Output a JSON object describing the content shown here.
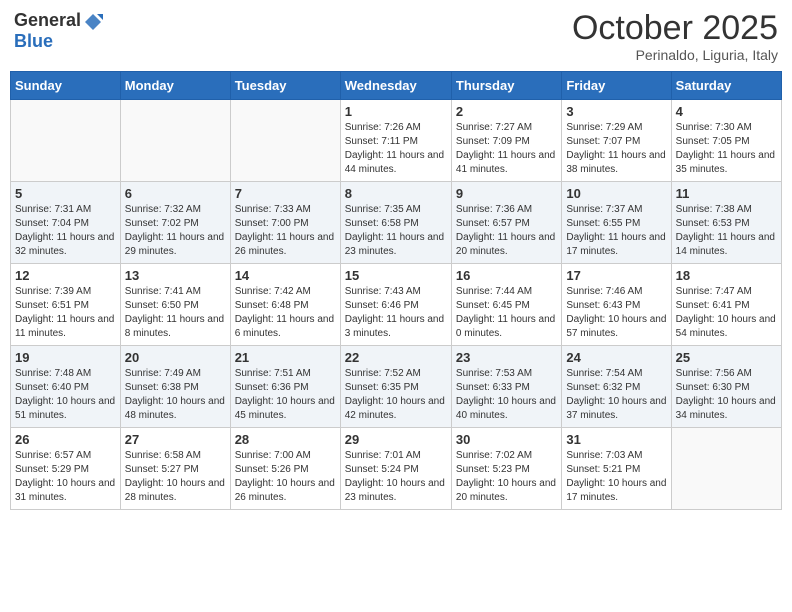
{
  "header": {
    "logo_general": "General",
    "logo_blue": "Blue",
    "month": "October 2025",
    "location": "Perinaldo, Liguria, Italy"
  },
  "days_of_week": [
    "Sunday",
    "Monday",
    "Tuesday",
    "Wednesday",
    "Thursday",
    "Friday",
    "Saturday"
  ],
  "weeks": [
    [
      {
        "day": "",
        "info": ""
      },
      {
        "day": "",
        "info": ""
      },
      {
        "day": "",
        "info": ""
      },
      {
        "day": "1",
        "info": "Sunrise: 7:26 AM\nSunset: 7:11 PM\nDaylight: 11 hours and 44 minutes."
      },
      {
        "day": "2",
        "info": "Sunrise: 7:27 AM\nSunset: 7:09 PM\nDaylight: 11 hours and 41 minutes."
      },
      {
        "day": "3",
        "info": "Sunrise: 7:29 AM\nSunset: 7:07 PM\nDaylight: 11 hours and 38 minutes."
      },
      {
        "day": "4",
        "info": "Sunrise: 7:30 AM\nSunset: 7:05 PM\nDaylight: 11 hours and 35 minutes."
      }
    ],
    [
      {
        "day": "5",
        "info": "Sunrise: 7:31 AM\nSunset: 7:04 PM\nDaylight: 11 hours and 32 minutes."
      },
      {
        "day": "6",
        "info": "Sunrise: 7:32 AM\nSunset: 7:02 PM\nDaylight: 11 hours and 29 minutes."
      },
      {
        "day": "7",
        "info": "Sunrise: 7:33 AM\nSunset: 7:00 PM\nDaylight: 11 hours and 26 minutes."
      },
      {
        "day": "8",
        "info": "Sunrise: 7:35 AM\nSunset: 6:58 PM\nDaylight: 11 hours and 23 minutes."
      },
      {
        "day": "9",
        "info": "Sunrise: 7:36 AM\nSunset: 6:57 PM\nDaylight: 11 hours and 20 minutes."
      },
      {
        "day": "10",
        "info": "Sunrise: 7:37 AM\nSunset: 6:55 PM\nDaylight: 11 hours and 17 minutes."
      },
      {
        "day": "11",
        "info": "Sunrise: 7:38 AM\nSunset: 6:53 PM\nDaylight: 11 hours and 14 minutes."
      }
    ],
    [
      {
        "day": "12",
        "info": "Sunrise: 7:39 AM\nSunset: 6:51 PM\nDaylight: 11 hours and 11 minutes."
      },
      {
        "day": "13",
        "info": "Sunrise: 7:41 AM\nSunset: 6:50 PM\nDaylight: 11 hours and 8 minutes."
      },
      {
        "day": "14",
        "info": "Sunrise: 7:42 AM\nSunset: 6:48 PM\nDaylight: 11 hours and 6 minutes."
      },
      {
        "day": "15",
        "info": "Sunrise: 7:43 AM\nSunset: 6:46 PM\nDaylight: 11 hours and 3 minutes."
      },
      {
        "day": "16",
        "info": "Sunrise: 7:44 AM\nSunset: 6:45 PM\nDaylight: 11 hours and 0 minutes."
      },
      {
        "day": "17",
        "info": "Sunrise: 7:46 AM\nSunset: 6:43 PM\nDaylight: 10 hours and 57 minutes."
      },
      {
        "day": "18",
        "info": "Sunrise: 7:47 AM\nSunset: 6:41 PM\nDaylight: 10 hours and 54 minutes."
      }
    ],
    [
      {
        "day": "19",
        "info": "Sunrise: 7:48 AM\nSunset: 6:40 PM\nDaylight: 10 hours and 51 minutes."
      },
      {
        "day": "20",
        "info": "Sunrise: 7:49 AM\nSunset: 6:38 PM\nDaylight: 10 hours and 48 minutes."
      },
      {
        "day": "21",
        "info": "Sunrise: 7:51 AM\nSunset: 6:36 PM\nDaylight: 10 hours and 45 minutes."
      },
      {
        "day": "22",
        "info": "Sunrise: 7:52 AM\nSunset: 6:35 PM\nDaylight: 10 hours and 42 minutes."
      },
      {
        "day": "23",
        "info": "Sunrise: 7:53 AM\nSunset: 6:33 PM\nDaylight: 10 hours and 40 minutes."
      },
      {
        "day": "24",
        "info": "Sunrise: 7:54 AM\nSunset: 6:32 PM\nDaylight: 10 hours and 37 minutes."
      },
      {
        "day": "25",
        "info": "Sunrise: 7:56 AM\nSunset: 6:30 PM\nDaylight: 10 hours and 34 minutes."
      }
    ],
    [
      {
        "day": "26",
        "info": "Sunrise: 6:57 AM\nSunset: 5:29 PM\nDaylight: 10 hours and 31 minutes."
      },
      {
        "day": "27",
        "info": "Sunrise: 6:58 AM\nSunset: 5:27 PM\nDaylight: 10 hours and 28 minutes."
      },
      {
        "day": "28",
        "info": "Sunrise: 7:00 AM\nSunset: 5:26 PM\nDaylight: 10 hours and 26 minutes."
      },
      {
        "day": "29",
        "info": "Sunrise: 7:01 AM\nSunset: 5:24 PM\nDaylight: 10 hours and 23 minutes."
      },
      {
        "day": "30",
        "info": "Sunrise: 7:02 AM\nSunset: 5:23 PM\nDaylight: 10 hours and 20 minutes."
      },
      {
        "day": "31",
        "info": "Sunrise: 7:03 AM\nSunset: 5:21 PM\nDaylight: 10 hours and 17 minutes."
      },
      {
        "day": "",
        "info": ""
      }
    ]
  ]
}
